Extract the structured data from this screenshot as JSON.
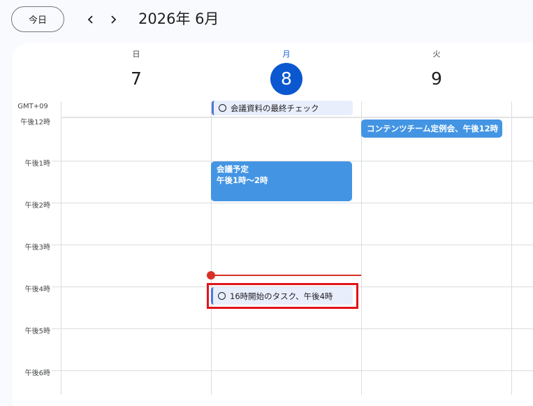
{
  "header": {
    "today_label": "今日",
    "prev_icon": "chevron-left-icon",
    "next_icon": "chevron-right-icon",
    "month_title": "2026年 6月"
  },
  "days": [
    {
      "dow": "日",
      "num": "7"
    },
    {
      "dow": "月",
      "num": "8"
    },
    {
      "dow": "火",
      "num": "9"
    }
  ],
  "timezone": "GMT+09",
  "hours": [
    "午後12時",
    "午後1時",
    "午後2時",
    "午後3時",
    "午後4時",
    "午後5時",
    "午後6時"
  ],
  "allday_task": {
    "title": "会議資料の最終チェック"
  },
  "events": {
    "content_team": {
      "title": "コンテンツチーム定例会、午後12時"
    },
    "meeting": {
      "title": "会議予定",
      "time": "午後1時〜2時"
    }
  },
  "task_4pm": {
    "title": "16時開始のタスク、午後4時"
  },
  "colors": {
    "accent": "#0b57d0",
    "event_blue": "#4395e3",
    "task_bg": "#e8eefc",
    "task_border": "#4f76d9",
    "now_line": "#d93025",
    "highlight": "#e0141a"
  }
}
